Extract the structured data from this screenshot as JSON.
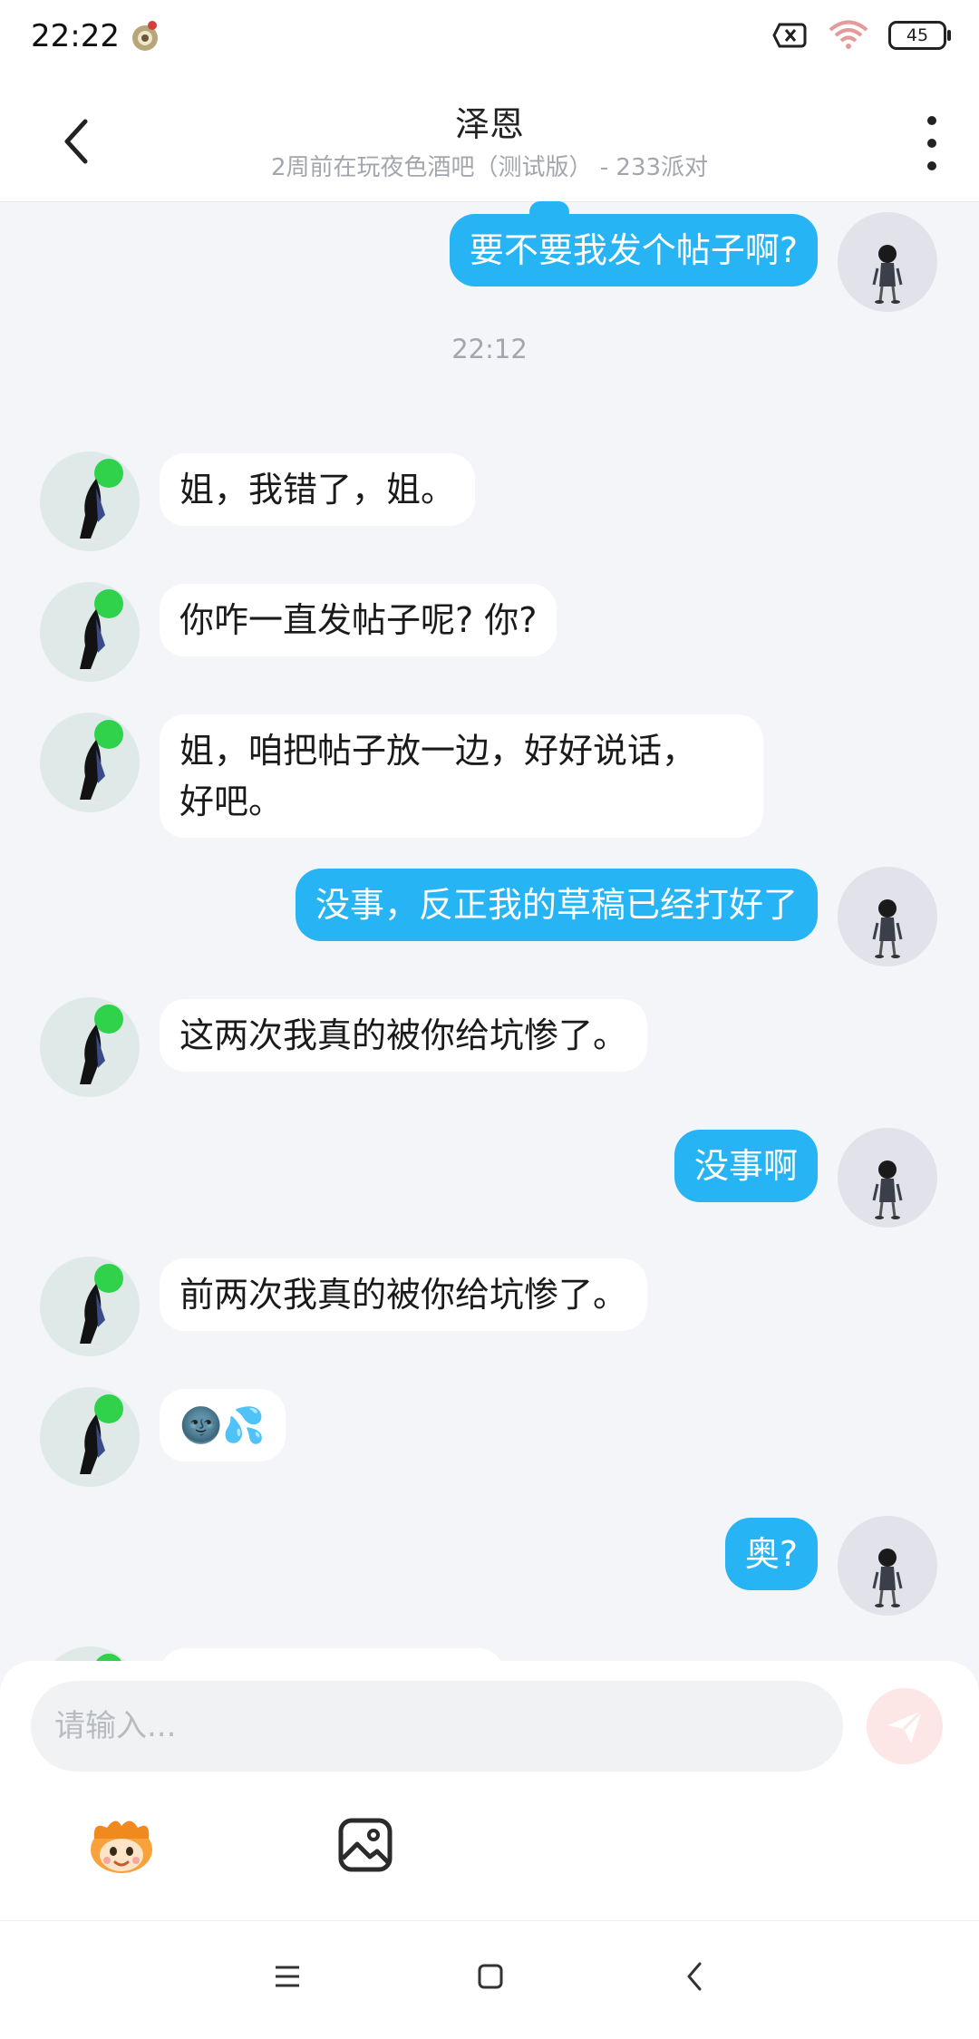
{
  "status": {
    "time": "22:22",
    "battery": "45"
  },
  "header": {
    "title": "泽恩",
    "subtitle": "2周前在玩夜色酒吧（测试版） - 233派对"
  },
  "chat": {
    "timestamp": "22:12",
    "messages": [
      {
        "sender": "me",
        "text": "要不要我发个帖子啊?"
      },
      {
        "sender": "other",
        "text": "姐，我错了，姐。"
      },
      {
        "sender": "other",
        "text": "你咋一直发帖子呢? 你?"
      },
      {
        "sender": "other",
        "text": "姐，咱把帖子放一边，好好说话，",
        "text2": "好吧。"
      },
      {
        "sender": "me",
        "text": "没事，反正我的草稿已经打好了"
      },
      {
        "sender": "other",
        "text": "这两次我真的被你给坑惨了。"
      },
      {
        "sender": "me",
        "text": "没事啊"
      },
      {
        "sender": "other",
        "text": "前两次我真的被你给坑惨了。"
      },
      {
        "sender": "other",
        "text": "🌚💦"
      },
      {
        "sender": "me",
        "text": "奥?"
      }
    ]
  },
  "composer": {
    "placeholder": "请输入..."
  },
  "colors": {
    "accent": "#27b4f5",
    "send_disabled": "#fde6e6"
  }
}
